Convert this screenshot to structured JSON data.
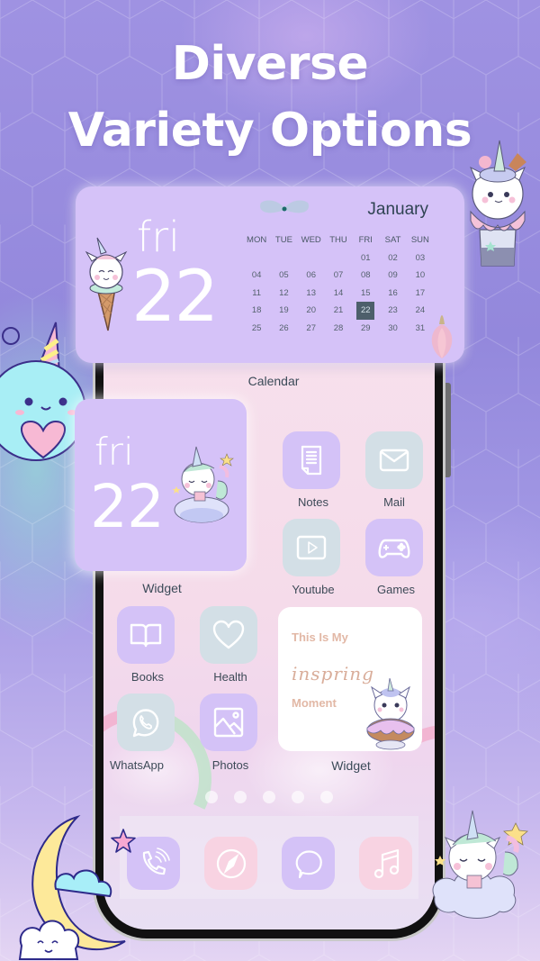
{
  "headline": {
    "line1": "Diverse",
    "line2": "Variety Options"
  },
  "calendar_widget": {
    "day_name": "fri",
    "day_number": "22",
    "month": "January",
    "weekdays": [
      "MON",
      "TUE",
      "WED",
      "THU",
      "FRI",
      "SAT",
      "SUN"
    ],
    "leading_blanks": 4,
    "days": [
      "01",
      "02",
      "03",
      "04",
      "05",
      "06",
      "07",
      "08",
      "09",
      "10",
      "11",
      "12",
      "13",
      "14",
      "15",
      "16",
      "17",
      "18",
      "19",
      "20",
      "21",
      "22",
      "23",
      "24",
      "25",
      "26",
      "27",
      "28",
      "29",
      "30",
      "31"
    ],
    "today": "22",
    "today_color": "#4d5f6b",
    "label": "Calendar"
  },
  "small_widget": {
    "day_name": "fri",
    "day_number": "22",
    "label": "Widget"
  },
  "apps": {
    "notes": {
      "label": "Notes",
      "icon": "notes-icon",
      "color": "#d4c2f7"
    },
    "mail": {
      "label": "Mail",
      "icon": "mail-icon",
      "color": "#d3dfe6"
    },
    "youtube": {
      "label": "Youtube",
      "icon": "play-icon",
      "color": "#d3dfe6"
    },
    "games": {
      "label": "Games",
      "icon": "gamepad-icon",
      "color": "#d4c2f7"
    },
    "books": {
      "label": "Books",
      "icon": "book-icon",
      "color": "#d4c2f7"
    },
    "health": {
      "label": "Health",
      "icon": "heart-icon",
      "color": "#d3dfe6"
    },
    "whatsapp": {
      "label": "WhatsApp",
      "icon": "whatsapp-icon",
      "color": "#d3dfe6"
    },
    "photos": {
      "label": "Photos",
      "icon": "image-icon",
      "color": "#d4c2f7"
    }
  },
  "quote_widget": {
    "line1": "This Is My",
    "script": "inspring",
    "line3": "Moment",
    "label": "Widget"
  },
  "page_indicator": {
    "count": 5
  },
  "dock": [
    {
      "name": "phone",
      "icon": "phone-icon",
      "color": "#d4c2f7"
    },
    {
      "name": "safari",
      "icon": "compass-icon",
      "color": "#f8d3e2"
    },
    {
      "name": "messages",
      "icon": "chat-bubble-icon",
      "color": "#d4c2f7"
    },
    {
      "name": "music",
      "icon": "music-note-icon",
      "color": "#f8d3e2"
    }
  ],
  "colors": {
    "widget_purple": "#d5c2f8",
    "icon_purple": "#d4c2f7",
    "icon_gray": "#d3dfe6",
    "icon_pink": "#f8d3e2",
    "label_text": "#3d4a57",
    "quote_text": "#e2b8a6"
  }
}
